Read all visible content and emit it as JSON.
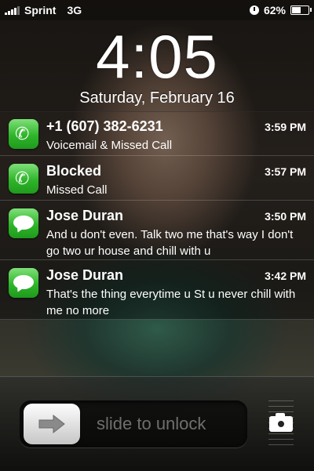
{
  "status": {
    "carrier": "Sprint",
    "network": "3G",
    "battery": "62%",
    "battery_level": 0.62
  },
  "lock": {
    "time": "4:05",
    "date": "Saturday, February 16"
  },
  "notifications": [
    {
      "icon": "phone-icon",
      "title": "+1 (607) 382-6231",
      "time": "3:59 PM",
      "body": "Voicemail & Missed Call"
    },
    {
      "icon": "phone-icon",
      "title": "Blocked",
      "time": "3:57 PM",
      "body": "Missed Call"
    },
    {
      "icon": "messages-icon",
      "title": "Jose Duran",
      "time": "3:50 PM",
      "body": "And u don't even. Talk two me that's way I don't go two ur house and chill with u"
    },
    {
      "icon": "messages-icon",
      "title": "Jose Duran",
      "time": "3:42 PM",
      "body": "That's the thing everytime u St u never chill with me no more"
    }
  ],
  "slider": {
    "label": "slide to unlock"
  }
}
